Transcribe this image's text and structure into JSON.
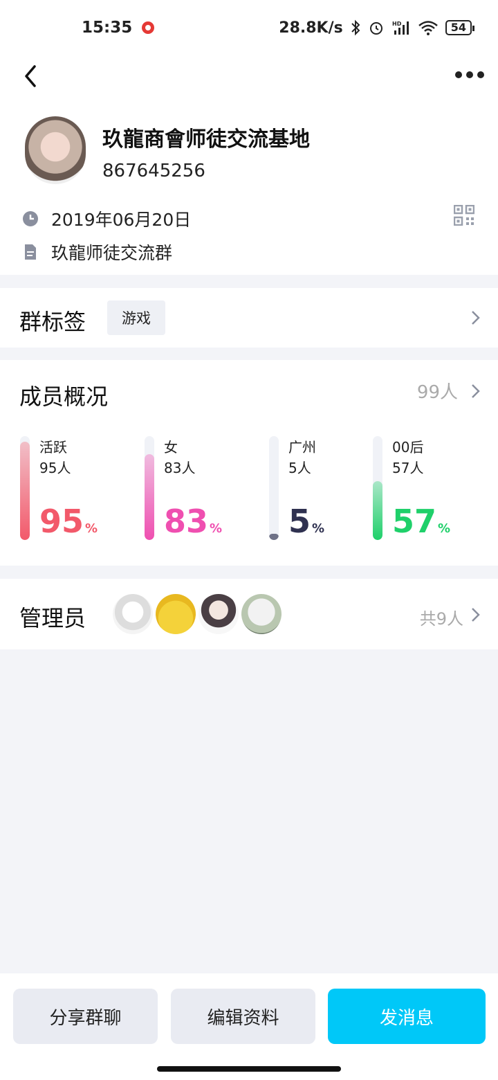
{
  "status_bar": {
    "time": "15:35",
    "network_speed": "28.8K/s",
    "battery": "54",
    "icons": [
      "app-notification-icon",
      "bluetooth-icon",
      "alarm-icon",
      "hd-signal-icon",
      "wifi-icon",
      "battery-icon"
    ]
  },
  "nav": {
    "back_icon": "back-arrow-icon",
    "more_icon": "more-dots-icon"
  },
  "group": {
    "name": "玖龍商會师徒交流基地",
    "id": "867645256",
    "created": "2019年06月20日",
    "description": "玖龍师徒交流群"
  },
  "tags": {
    "title": "群标签",
    "chip": "游戏"
  },
  "members": {
    "title": "成员概况",
    "count": "99人",
    "stats": [
      {
        "label": "活跃",
        "count": "95人",
        "percent": 95,
        "percent_text": "95",
        "color": "#f2596a"
      },
      {
        "label": "女",
        "count": "83人",
        "percent": 83,
        "percent_text": "83",
        "color": "#ef4fb0"
      },
      {
        "label": "广州",
        "count": "5人",
        "percent": 5,
        "percent_text": "5",
        "color": "#2f3150"
      },
      {
        "label": "00后",
        "count": "57人",
        "percent": 57,
        "percent_text": "57",
        "color": "#1fd06a"
      }
    ],
    "percent_sign": "%"
  },
  "admins": {
    "title": "管理员",
    "total": "共9人"
  },
  "actions": {
    "share": "分享群聊",
    "edit": "编辑资料",
    "send": "发消息"
  }
}
